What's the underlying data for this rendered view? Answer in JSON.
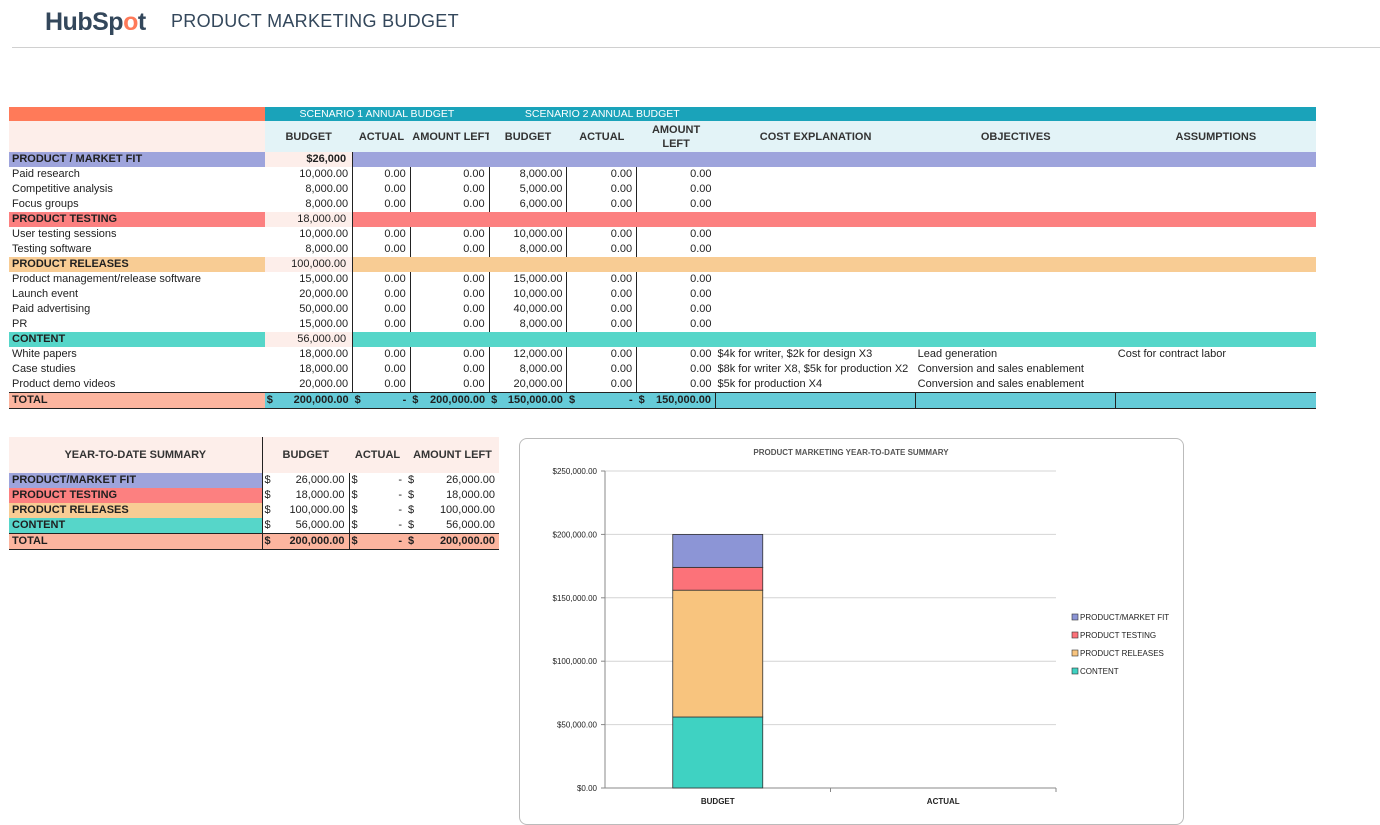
{
  "app": {
    "logo": "HubSpot",
    "title": "PRODUCT MARKETING BUDGET"
  },
  "main_table": {
    "scenario1": "SCENARIO 1 ANNUAL BUDGET",
    "scenario2": "SCENARIO 2 ANNUAL BUDGET",
    "cols": {
      "budget": "BUDGET",
      "actual": "ACTUAL",
      "amount_left": "AMOUNT LEFT",
      "amount_left_2a": "AMOUNT",
      "amount_left_2b": "LEFT",
      "cost_explanation": "COST EXPLANATION",
      "objectives": "OBJECTIVES",
      "assumptions": "ASSUMPTIONS"
    },
    "sections": [
      {
        "name": "PRODUCT / MARKET FIT",
        "total": "$26,000",
        "rows": [
          {
            "item": "Paid research",
            "b1": "10,000.00",
            "a1": "0.00",
            "l1": "0.00",
            "b2": "8,000.00",
            "a2": "0.00",
            "l2": "0.00",
            "cost": "",
            "obj": "",
            "asm": ""
          },
          {
            "item": "Competitive analysis",
            "b1": "8,000.00",
            "a1": "0.00",
            "l1": "0.00",
            "b2": "5,000.00",
            "a2": "0.00",
            "l2": "0.00",
            "cost": "",
            "obj": "",
            "asm": ""
          },
          {
            "item": "Focus groups",
            "b1": "8,000.00",
            "a1": "0.00",
            "l1": "0.00",
            "b2": "6,000.00",
            "a2": "0.00",
            "l2": "0.00",
            "cost": "",
            "obj": "",
            "asm": ""
          }
        ]
      },
      {
        "name": "PRODUCT TESTING",
        "total": "18,000.00",
        "rows": [
          {
            "item": "User testing sessions",
            "b1": "10,000.00",
            "a1": "0.00",
            "l1": "0.00",
            "b2": "10,000.00",
            "a2": "0.00",
            "l2": "0.00",
            "cost": "",
            "obj": "",
            "asm": ""
          },
          {
            "item": "Testing software",
            "b1": "8,000.00",
            "a1": "0.00",
            "l1": "0.00",
            "b2": "8,000.00",
            "a2": "0.00",
            "l2": "0.00",
            "cost": "",
            "obj": "",
            "asm": ""
          }
        ]
      },
      {
        "name": "PRODUCT RELEASES",
        "total": "100,000.00",
        "rows": [
          {
            "item": "Product management/release software",
            "b1": "15,000.00",
            "a1": "0.00",
            "l1": "0.00",
            "b2": "15,000.00",
            "a2": "0.00",
            "l2": "0.00",
            "cost": "",
            "obj": "",
            "asm": ""
          },
          {
            "item": "Launch event",
            "b1": "20,000.00",
            "a1": "0.00",
            "l1": "0.00",
            "b2": "10,000.00",
            "a2": "0.00",
            "l2": "0.00",
            "cost": "",
            "obj": "",
            "asm": ""
          },
          {
            "item": "Paid advertising",
            "b1": "50,000.00",
            "a1": "0.00",
            "l1": "0.00",
            "b2": "40,000.00",
            "a2": "0.00",
            "l2": "0.00",
            "cost": "",
            "obj": "",
            "asm": ""
          },
          {
            "item": "PR",
            "b1": "15,000.00",
            "a1": "0.00",
            "l1": "0.00",
            "b2": "8,000.00",
            "a2": "0.00",
            "l2": "0.00",
            "cost": "",
            "obj": "",
            "asm": ""
          }
        ]
      },
      {
        "name": "CONTENT",
        "total": "56,000.00",
        "rows": [
          {
            "item": "White papers",
            "b1": "18,000.00",
            "a1": "0.00",
            "l1": "0.00",
            "b2": "12,000.00",
            "a2": "0.00",
            "l2": "0.00",
            "cost": "$4k for writer, $2k for design X3",
            "obj": "Lead generation",
            "asm": "Cost for contract labor"
          },
          {
            "item": "Case studies",
            "b1": "18,000.00",
            "a1": "0.00",
            "l1": "0.00",
            "b2": "8,000.00",
            "a2": "0.00",
            "l2": "0.00",
            "cost": "$8k for writer X8, $5k for production X2",
            "obj": "Conversion and sales enablement",
            "asm": ""
          },
          {
            "item": "Product demo videos",
            "b1": "20,000.00",
            "a1": "0.00",
            "l1": "0.00",
            "b2": "20,000.00",
            "a2": "0.00",
            "l2": "0.00",
            "cost": "$5k for production X4",
            "obj": "Conversion and sales enablement",
            "asm": ""
          }
        ]
      }
    ],
    "total": {
      "label": "TOTAL",
      "b1": "200,000.00",
      "a1": "-",
      "l1": "200,000.00",
      "b2": "150,000.00",
      "a2": "-",
      "l2": "150,000.00",
      "currency": "$"
    }
  },
  "summary": {
    "title": "YEAR-TO-DATE SUMMARY",
    "cols": {
      "budget": "BUDGET",
      "actual": "ACTUAL",
      "amount_left": "AMOUNT LEFT"
    },
    "currency": "$",
    "rows": [
      {
        "label": "PRODUCT/MARKET FIT",
        "budget": "26,000.00",
        "actual": "-",
        "left": "26,000.00"
      },
      {
        "label": "PRODUCT TESTING",
        "budget": "18,000.00",
        "actual": "-",
        "left": "18,000.00"
      },
      {
        "label": "PRODUCT RELEASES",
        "budget": "100,000.00",
        "actual": "-",
        "left": "100,000.00"
      },
      {
        "label": "CONTENT",
        "budget": "56,000.00",
        "actual": "-",
        "left": "56,000.00"
      }
    ],
    "total": {
      "label": "TOTAL",
      "budget": "200,000.00",
      "actual": "-",
      "left": "200,000.00"
    }
  },
  "chart_data": {
    "type": "bar",
    "stacked": true,
    "title": "PRODUCT MARKETING YEAR-TO-DATE SUMMARY",
    "categories": [
      "BUDGET",
      "ACTUAL"
    ],
    "series": [
      {
        "name": "PRODUCT/MARKET FIT",
        "values": [
          26000,
          0
        ],
        "color": "#8c95d6"
      },
      {
        "name": "PRODUCT TESTING",
        "values": [
          18000,
          0
        ],
        "color": "#fc7279"
      },
      {
        "name": "PRODUCT RELEASES",
        "values": [
          100000,
          0
        ],
        "color": "#f8c47e"
      },
      {
        "name": "CONTENT",
        "values": [
          56000,
          0
        ],
        "color": "#3fd2c2"
      }
    ],
    "ylim": [
      0,
      250000
    ],
    "yticks": [
      "$0.00",
      "$50,000.00",
      "$100,000.00",
      "$150,000.00",
      "$200,000.00",
      "$250,000.00"
    ],
    "grid": true,
    "legend": "right"
  }
}
